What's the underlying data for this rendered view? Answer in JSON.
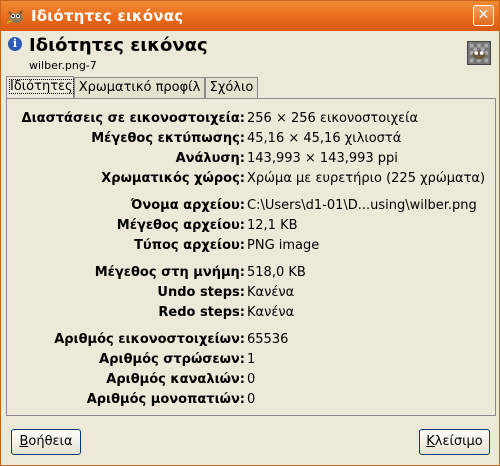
{
  "window": {
    "title": "Ιδιότητες εικόνας",
    "close_glyph": "✕"
  },
  "header": {
    "title": "Ιδιότητες εικόνας",
    "subtitle": "wilber.png-7",
    "info_glyph": "i"
  },
  "tabs": [
    {
      "label": "Ιδιότητες",
      "active": true
    },
    {
      "label": "Χρωματικό προφίλ",
      "active": false
    },
    {
      "label": "Σχόλιο",
      "active": false
    }
  ],
  "properties": [
    {
      "label": "Διαστάσεις σε εικονοστοιχεία:",
      "value": "256 × 256 εικονοστοιχεία"
    },
    {
      "label": "Μέγεθος εκτύπωσης:",
      "value": "45,16 × 45,16 χιλιοστά"
    },
    {
      "label": "Ανάλυση:",
      "value": "143,993 × 143,993 ppi"
    },
    {
      "label": "Χρωματικός χώρος:",
      "value": "Χρώμα με ευρετήριο (225 χρώματα)"
    },
    {
      "label": "Όνομα αρχείου:",
      "value": "C:\\Users\\d1-01\\D...using\\wilber.png"
    },
    {
      "label": "Μέγεθος αρχείου:",
      "value": "12,1 KB"
    },
    {
      "label": "Τύπος αρχείου:",
      "value": "PNG image"
    },
    {
      "label": "Μέγεθος στη μνήμη:",
      "value": "518,0 KB"
    },
    {
      "label": "Undo steps:",
      "value": "Κανένα"
    },
    {
      "label": "Redo steps:",
      "value": "Κανένα"
    },
    {
      "label": "Αριθμός εικονοστοιχείων:",
      "value": "65536"
    },
    {
      "label": "Αριθμός στρώσεων:",
      "value": "1"
    },
    {
      "label": "Αριθμός καναλιών:",
      "value": "0"
    },
    {
      "label": "Αριθμός μονοπατιών:",
      "value": "0"
    }
  ],
  "buttons": {
    "help_mnemonic": "Β",
    "help_rest": "οήθεια",
    "close_mnemonic": "Κ",
    "close_rest": "λείσιμο"
  }
}
